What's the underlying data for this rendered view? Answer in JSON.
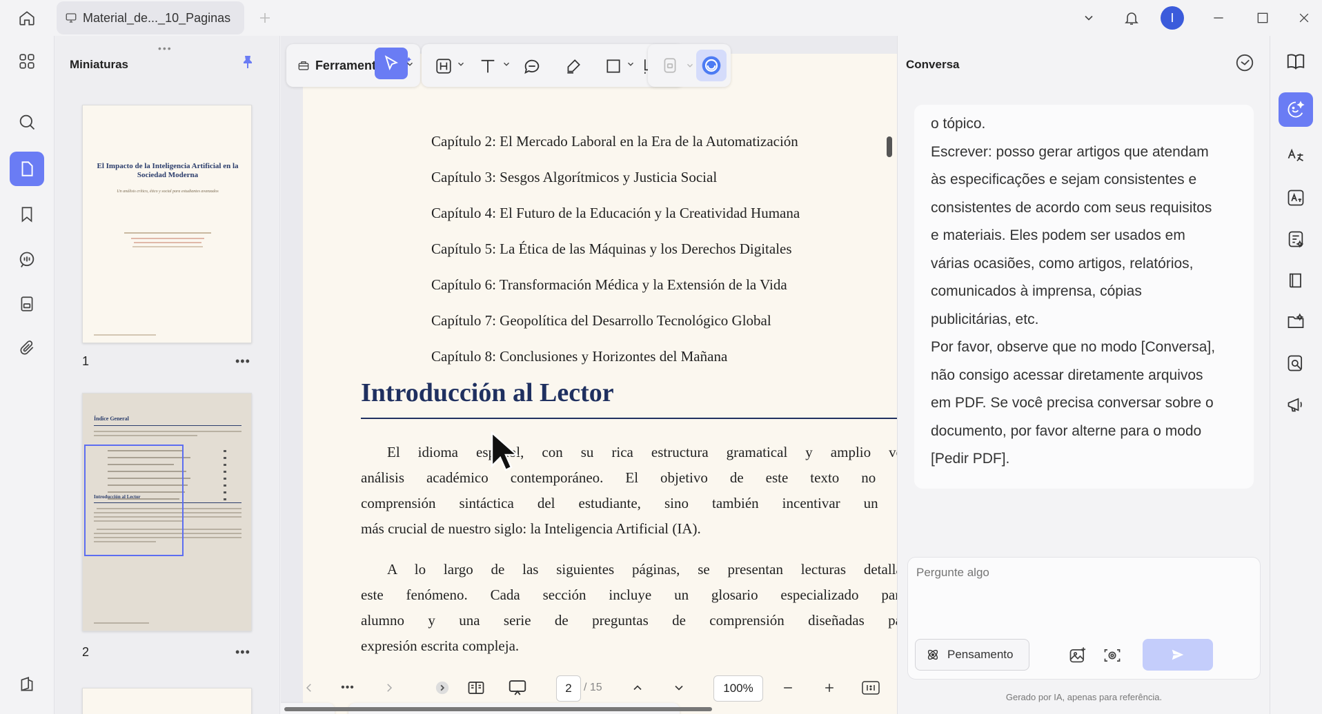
{
  "titlebar": {
    "tab_title": "Material_de..._10_Paginas",
    "avatar_initial": "I"
  },
  "thumbnails": {
    "title": "Miniaturas",
    "grip": "•••",
    "more": "•••",
    "pages": [
      {
        "number": "1"
      },
      {
        "number": "2"
      }
    ],
    "page1": {
      "title": "El Impacto de la Inteligencia Artificial en la Sociedad Moderna",
      "subtitle": "Un análisis crítico, ético y social para estudiantes avanzados"
    },
    "page2": {
      "heading": "Índice General",
      "section": "Introducción al Lector"
    }
  },
  "toolbar": {
    "tools_label": "Ferramentas"
  },
  "document": {
    "toc": [
      "Capítulo 2: El Mercado Laboral en la Era de la Automatización",
      "Capítulo 3: Sesgos Algorítmicos y Justicia Social",
      "Capítulo 4: El Futuro de la Educación y la Creatividad Humana",
      "Capítulo 5: La Ética de las Máquinas y los Derechos Digitales",
      "Capítulo 6: Transformación Médica y la Extensión de la Vida",
      "Capítulo 7: Geopolítica del Desarrollo Tecnológico Global",
      "Capítulo 8: Conclusiones y Horizontes del Mañana"
    ],
    "heading": "Introducción al Lector",
    "paragraph1": [
      "El idioma español, con su rica estructura gramatical y amplio vocabulario, es un",
      "análisis académico contemporáneo. El objetivo de este texto no es solo mejorar",
      "comprensión sintáctica del estudiante, sino también incentivar un debate intelectual",
      "más crucial de nuestro siglo: la Inteligencia Artificial (IA)."
    ],
    "paragraph2": [
      "A lo largo de las siguientes páginas, se presentan lecturas detalladas que abarcan",
      "este fenómeno. Cada sección incluye un glosario especializado para enriquecer el",
      "alumno y una serie de preguntas de comprensión diseñadas para fomentar el",
      "expresión escrita compleja."
    ]
  },
  "bottombar": {
    "more": "•••",
    "current_page": "2",
    "total_pages": "/ 15",
    "zoom": "100%"
  },
  "chat": {
    "title": "Conversa",
    "message_lines": [
      "o tópico.",
      "Escrever: posso gerar artigos que atendam",
      "às especificações e sejam consistentes e",
      "consistentes de acordo com seus requisitos",
      "e materiais. Eles podem ser usados em",
      "várias ocasiões, como artigos, relatórios,",
      "comunicados à imprensa, cópias",
      "publicitárias, etc.",
      "Por favor, observe que no modo [Conversa],",
      "não consigo acessar diretamente arquivos",
      "em PDF. Se você precisa conversar sobre o",
      "documento, por favor alterne para o modo",
      "[Pedir PDF]."
    ],
    "input_placeholder": "Pergunte algo",
    "thinking_label": "Pensamento",
    "footer": "Gerado por IA, apenas para referência."
  },
  "colors": {
    "accent": "#6a7cf4",
    "heading_blue": "#1f3060",
    "page_bg": "#fbf7ef"
  }
}
